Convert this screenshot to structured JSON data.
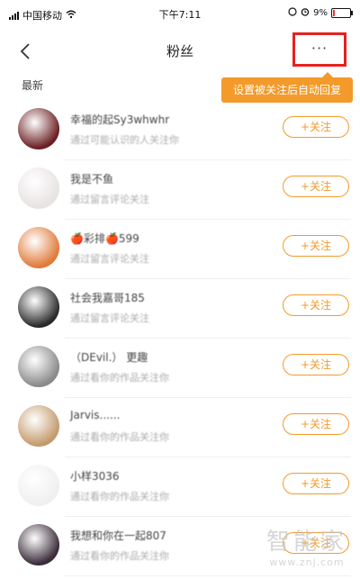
{
  "status_bar": {
    "carrier": "中国移动",
    "time": "下午7:11",
    "battery": "9%",
    "battery_level": 0.09
  },
  "nav": {
    "title": "粉丝",
    "more_label": "···"
  },
  "tooltip": {
    "text": "设置被关注后自动回复"
  },
  "section": {
    "label": "最新"
  },
  "fans": [
    {
      "name": "幸福的起Sy3whwhr",
      "subtitle": "通过可能认识的人关注你",
      "follow_label": "+关注"
    },
    {
      "name": "我是不鱼",
      "subtitle": "通过留言评论关注",
      "follow_label": "+关注"
    },
    {
      "name": "🍎彩排🍎599",
      "subtitle": "通过留言评论关注",
      "follow_label": "+关注"
    },
    {
      "name": "社会我嘉哥185",
      "subtitle": "通过留言评论关注",
      "follow_label": "+关注"
    },
    {
      "name": "（DEvil.） 更趣",
      "subtitle": "通过看你的作品关注你",
      "follow_label": "+关注"
    },
    {
      "name": "Jarvis......",
      "subtitle": "通过看你的作品关注你",
      "follow_label": "+关注"
    },
    {
      "name": "小样3036",
      "subtitle": "通过看你的作品关注你",
      "follow_label": "+关注"
    },
    {
      "name": "我想和你在一起807",
      "subtitle": "通过看你的作品关注你",
      "follow_label": "+关注"
    }
  ],
  "watermark": {
    "title": "智能家",
    "url": "www.znj.com"
  },
  "colors": {
    "accent": "#f39a2a",
    "highlight_border": "#e8211d",
    "avatar_colors": [
      "#6b1f22",
      "#e8e2e2",
      "#e07a3a",
      "#2a2a2a",
      "#8a8a8a",
      "#c49a6c",
      "#efefef",
      "#3a2c3a"
    ]
  },
  "icons": {
    "back": "chevron-left-icon",
    "more": "more-dots-icon",
    "wifi": "wifi-icon",
    "signal": "signal-icon",
    "alarm": "alarm-icon",
    "battery": "battery-icon"
  }
}
